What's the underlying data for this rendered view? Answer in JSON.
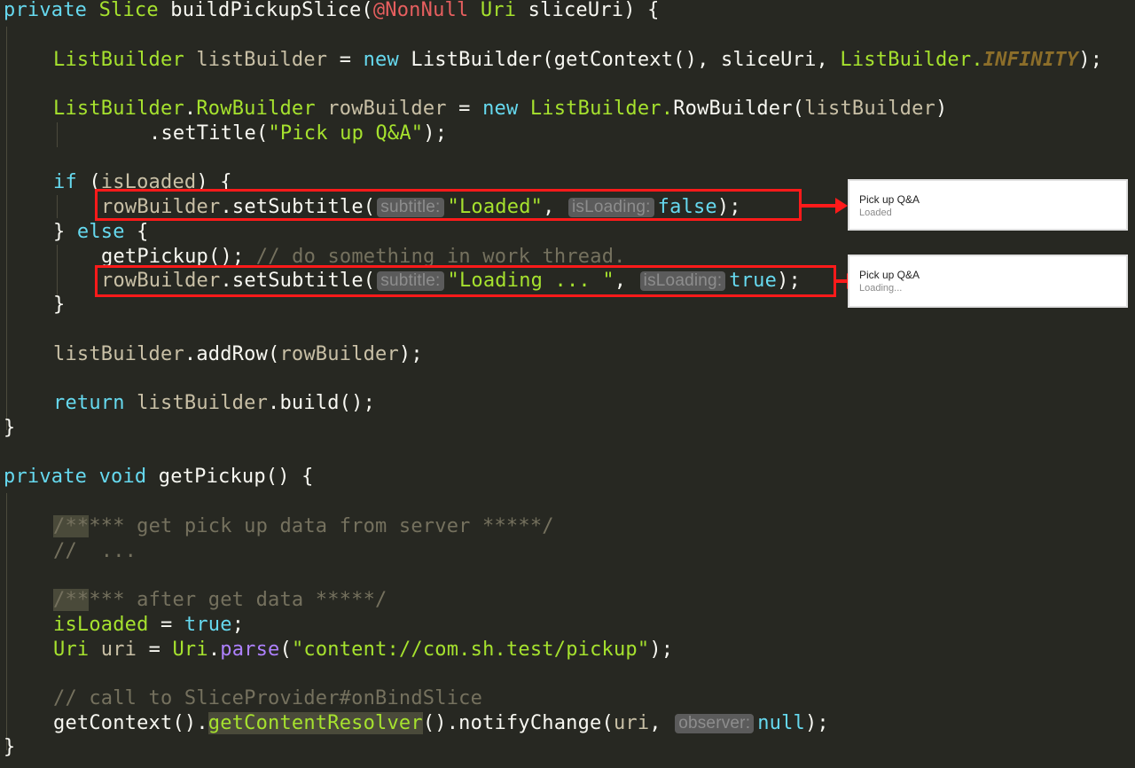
{
  "code": {
    "method1": {
      "kw_private": "private",
      "ret_type": "Slice",
      "name": "buildPickupSlice(",
      "annotation": "@NonNull",
      "param_type": "Uri",
      "param_rest": " sliceUri) {"
    },
    "line_listbuilder": {
      "type": "ListBuilder",
      "var": " listBuilder",
      "eq": " = ",
      "kw_new": "new",
      "ctor": " ListBuilder(getContext(), sliceUri, ",
      "const_owner": "ListBuilder.",
      "const": "INFINITY",
      "end": ");"
    },
    "line_rowbuilder": {
      "type1": "ListBuilder",
      "dot": ".",
      "type2": "RowBuilder",
      "var": " rowBuilder",
      "eq": " = ",
      "kw_new": "new",
      "ctor_owner": " ListBuilder.",
      "ctor": "RowBuilder(",
      "arg": "listBuilder",
      "end": ")"
    },
    "line_settitle": {
      "call": ".setTitle(",
      "str": "\"Pick up Q&A\"",
      "end": ");"
    },
    "line_if": {
      "kw_if": "if",
      "open": " (",
      "cond": "isLoaded",
      "close": ") {"
    },
    "line_sub_loaded": {
      "recv": "rowBuilder",
      "call": ".setSubtitle(",
      "hint1": "subtitle:",
      "str": "\"Loaded\"",
      "comma": ",",
      "hint2": "isLoading:",
      "bool": "false",
      "end": ");"
    },
    "line_else": {
      "brace": "} ",
      "kw_else": "else",
      "open": " {"
    },
    "line_getpickup": {
      "call": "getPickup();",
      "comment": " // do something in work thread."
    },
    "line_sub_loading": {
      "recv": "rowBuilder",
      "call": ".setSubtitle(",
      "hint1": "subtitle:",
      "str": "\"Loading ... \"",
      "comma": ",",
      "hint2": "isLoading:",
      "bool": "true",
      "end": ");"
    },
    "line_close_if": {
      "text": "}"
    },
    "line_addrow": {
      "recv": "listBuilder",
      "call": ".addRow(",
      "arg": "rowBuilder",
      "end": ");"
    },
    "line_return": {
      "kw_return": "return",
      "recv": " listBuilder",
      "call": ".build();"
    },
    "line_close_method1": {
      "text": "}"
    },
    "method2": {
      "kw_private": "private",
      "kw_void": "void",
      "name": " getPickup() {"
    },
    "line_cm1": {
      "hl": "/**",
      "rest": "*** get pick up data from server *****/"
    },
    "line_cm2": {
      "text": "//  ..."
    },
    "line_cm3": {
      "hl": "/**",
      "rest": "*** after get data *****/"
    },
    "line_assign": {
      "var": "isLoaded",
      "eq": " = ",
      "val": "true",
      "end": ";"
    },
    "line_uri": {
      "type": "Uri",
      "var": " uri",
      "eq": " = ",
      "owner": "Uri",
      "dot": ".",
      "meth": "parse",
      "open": "(",
      "str": "\"content://com.sh.test/pickup\"",
      "end": ");"
    },
    "line_cm4": {
      "text": "// call to SliceProvider#onBindSlice"
    },
    "line_notify": {
      "pre": "getContext().",
      "hl": "getContentResolver",
      "mid": "().notifyChange(",
      "arg": "uri",
      "comma": ",",
      "hint": "observer:",
      "val": "null",
      "end": ");"
    },
    "line_close_method2": {
      "text": "}"
    }
  },
  "previews": [
    {
      "title": "Pick up Q&A",
      "subtitle": "Loaded"
    },
    {
      "title": "Pick up Q&A",
      "subtitle": "Loading..."
    }
  ],
  "colors": {
    "background": "#272822",
    "keyword": "#66d9ef",
    "type": "#a6e22e",
    "identifier": "#c9c0a6",
    "string": "#a6e22e",
    "comment": "#75715e",
    "annotation": "#e65f5f",
    "highlight_box": "#ff1a1a"
  }
}
